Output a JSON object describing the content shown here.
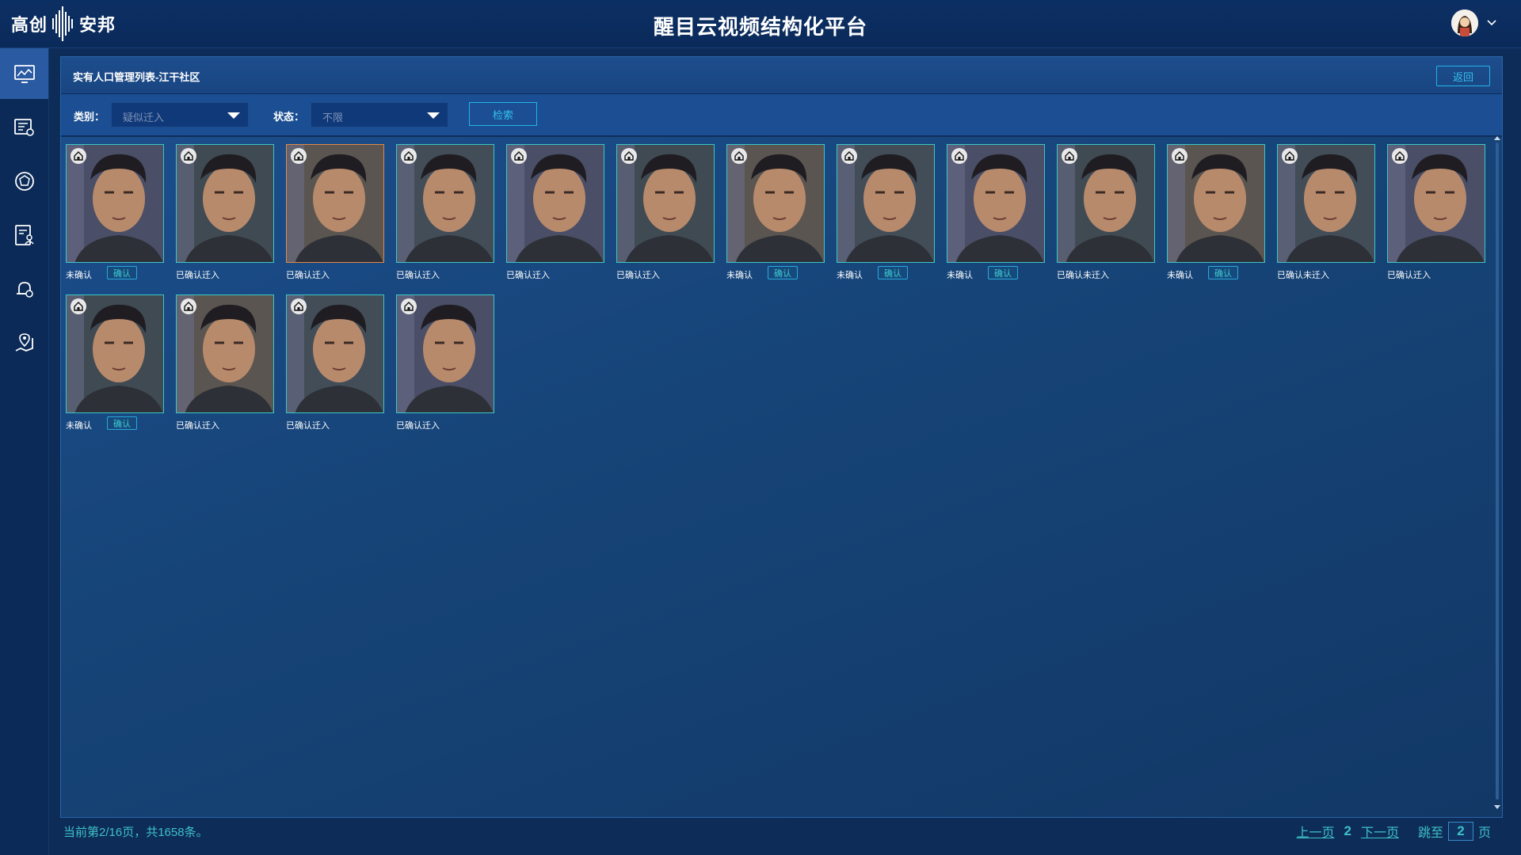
{
  "header": {
    "brand_left": "高创",
    "brand_right": "安邦",
    "app_title": "醒目云视频结构化平台"
  },
  "sidebar": {
    "items": [
      {
        "name": "monitor-icon",
        "active": true
      },
      {
        "name": "device-settings-icon",
        "active": false
      },
      {
        "name": "face-recognition-icon",
        "active": false
      },
      {
        "name": "person-list-icon",
        "active": false
      },
      {
        "name": "alarm-icon",
        "active": false
      },
      {
        "name": "map-icon",
        "active": false
      }
    ]
  },
  "panel": {
    "title": "实有人口管理列表-江干社区",
    "back_label": "返回"
  },
  "filters": {
    "category_label": "类别：",
    "category_value": "疑似迁入",
    "status_label": "状态：",
    "status_value": "不限",
    "search_label": "检索"
  },
  "cards": [
    {
      "caption": "未确认",
      "confirm": "确认",
      "highlight": false
    },
    {
      "caption": "已确认迁入",
      "confirm": null,
      "highlight": false
    },
    {
      "caption": "已确认迁入",
      "confirm": null,
      "highlight": true
    },
    {
      "caption": "已确认迁入",
      "confirm": null,
      "highlight": false
    },
    {
      "caption": "已确认迁入",
      "confirm": null,
      "highlight": false
    },
    {
      "caption": "已确认迁入",
      "confirm": null,
      "highlight": false
    },
    {
      "caption": "未确认",
      "confirm": "确认",
      "highlight": false
    },
    {
      "caption": "未确认",
      "confirm": "确认",
      "highlight": false
    },
    {
      "caption": "未确认",
      "confirm": "确认",
      "highlight": false
    },
    {
      "caption": "已确认未迁入",
      "confirm": null,
      "highlight": false
    },
    {
      "caption": "未确认",
      "confirm": "确认",
      "highlight": false
    },
    {
      "caption": "已确认未迁入",
      "confirm": null,
      "highlight": false
    },
    {
      "caption": "已确认迁入",
      "confirm": null,
      "highlight": false
    },
    {
      "caption": "未确认",
      "confirm": "确认",
      "highlight": false
    },
    {
      "caption": "已确认迁入",
      "confirm": null,
      "highlight": false
    },
    {
      "caption": "已确认迁入",
      "confirm": null,
      "highlight": false
    },
    {
      "caption": "已确认迁入",
      "confirm": null,
      "highlight": false
    }
  ],
  "footer": {
    "info": "当前第2/16页，共1658条。",
    "prev": "上一页",
    "current_page": "2",
    "next": "下一页",
    "jump_label": "跳至",
    "jump_value": "2",
    "page_suffix": "页"
  },
  "colors": {
    "accent": "#3ec0c6",
    "card_border": "#3cc7c6",
    "highlight_border": "#e0894a"
  }
}
